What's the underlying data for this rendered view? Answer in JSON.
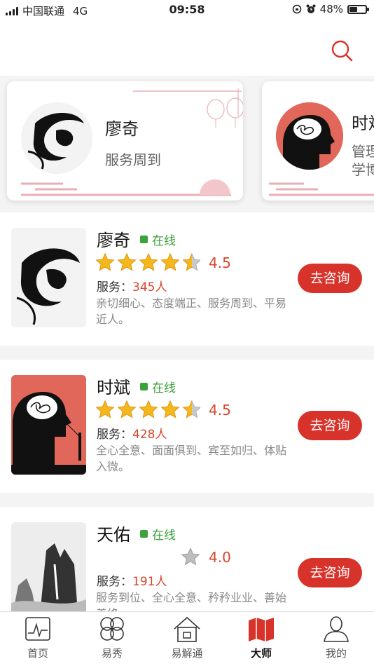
{
  "status_bar": {
    "carrier": "中国联通",
    "network": "4G",
    "time": "09:58",
    "battery": "48%",
    "battery_level": 0.48
  },
  "header": {
    "search_icon": "search-icon"
  },
  "featured": [
    {
      "name": "廖奇",
      "desc": "服务周到"
    },
    {
      "name": "时斌",
      "desc1": "管理",
      "desc2": "学博"
    }
  ],
  "masters": [
    {
      "name": "廖奇",
      "status": "在线",
      "stars": 4.5,
      "rating": "4.5",
      "service_label": "服务：",
      "service_count": "345人",
      "desc": "亲切细心、态度端正、服务周到、平易近人。",
      "button": "去咨询"
    },
    {
      "name": "时斌",
      "status": "在线",
      "stars": 4.5,
      "rating": "4.5",
      "service_label": "服务：",
      "service_count": "428人",
      "desc": "全心全意、面面俱到、宾至如归、体贴入微。",
      "button": "去咨询"
    },
    {
      "name": "天佑",
      "status": "在线",
      "stars": 1,
      "rating": "4.0",
      "service_label": "服务：",
      "service_count": "191人",
      "desc": "服务到位、全心全意、矜矜业业、善始善终。",
      "button": "去咨询"
    }
  ],
  "tabs": [
    {
      "label": "首页",
      "icon": "home-chart-icon"
    },
    {
      "label": "易秀",
      "icon": "clover-icon"
    },
    {
      "label": "易解通",
      "icon": "house-icon"
    },
    {
      "label": "大师",
      "icon": "map-icon"
    },
    {
      "label": "我的",
      "icon": "user-icon"
    }
  ],
  "colors": {
    "accent": "#d8332b",
    "online": "#3aa23a",
    "rating": "#d9452b"
  }
}
